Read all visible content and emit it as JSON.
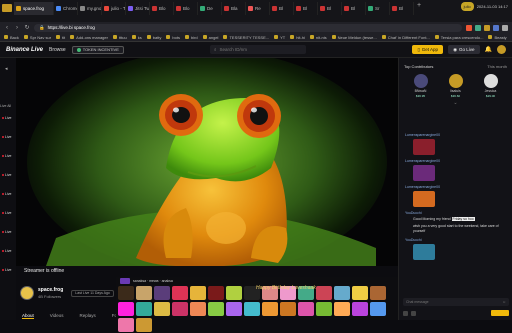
{
  "browser": {
    "tabs": [
      {
        "label": "space.frog",
        "color": "#d9a21a",
        "active": true
      },
      {
        "label": "Chrome We",
        "color": "#4a8af4"
      },
      {
        "label": "my.gnome.h",
        "color": "#888888"
      },
      {
        "label": "julio - Thonie",
        "color": "#e9483b"
      },
      {
        "label": "Jitsi Twent",
        "color": "#7b5df2"
      },
      {
        "label": "Blo",
        "color": "#c33"
      },
      {
        "label": "Blo",
        "color": "#c33"
      },
      {
        "label": "De",
        "color": "#3a7"
      },
      {
        "label": "Bla",
        "color": "#c33"
      },
      {
        "label": "Re",
        "color": "#e55"
      },
      {
        "label": "Bl",
        "color": "#c33"
      },
      {
        "label": "Bl",
        "color": "#c33"
      },
      {
        "label": "Bl",
        "color": "#c33"
      },
      {
        "label": "Bl",
        "color": "#c33"
      },
      {
        "label": "Sr",
        "color": "#3a7"
      },
      {
        "label": "Bl",
        "color": "#c33"
      }
    ],
    "clock": "2024-11-03 14:17",
    "user_chip": "julio",
    "url_host": "space.frog",
    "url_full": "https://live.bi space.frog",
    "bookmarks": [
      "Back",
      "Spr Nav sur",
      "tit",
      "Add-ons manager",
      "tttuu",
      "ks",
      "batty",
      "bots",
      "bird",
      "angel",
      "TESSERITY TESSE...",
      "YT",
      "hit-hi",
      "nit-nis",
      "Neue Meldun (tesse...",
      "Chat' in Different Font...",
      "Tersia para crescendo...",
      "Beasty",
      "crossroy",
      "Other Bookmarks"
    ]
  },
  "site": {
    "logo": "Binance Live",
    "browse": "Browse",
    "token_label": "TOKEN INCENTIVE",
    "search_placeholder": "Search ID/nm",
    "get_app": "Get App",
    "go_live": "Go Live"
  },
  "sidebar": {
    "section_label": "Live All",
    "live_label": "Live",
    "live_count": 9
  },
  "stream": {
    "status": "Streamer is offline",
    "channel_name": "space.frog",
    "followers": "4B Followers",
    "last_live": "Last Live 11 Days Ago",
    "tabs": [
      "About",
      "Videos",
      "Replays",
      "Fol"
    ]
  },
  "overlay": {
    "top_label": "sanaksa · mewa · anaksa",
    "birthday_text": "Happy Birthday Loveshaak"
  },
  "right_panel": {
    "top_contributors": "Top Contributors",
    "period": "This month",
    "contributors": [
      {
        "name": "BNwaN",
        "amount": "$36.95",
        "color": "#4a4a7a"
      },
      {
        "name": "lisaluis",
        "amount": "$36.60",
        "color": "#c69b26"
      },
      {
        "name": "Jessica",
        "amount": "$29.00",
        "color": "#dddddd"
      }
    ],
    "chat": [
      {
        "user": "Lumensparenargine00",
        "type": "gift",
        "color": "#8a1f2c"
      },
      {
        "user": "Lumensparenargine00",
        "type": "gift",
        "color": "#6b2a7a"
      },
      {
        "user": "Lumensparenargine00",
        "type": "gift",
        "color": "#d46a20"
      },
      {
        "user": "YouDucchi",
        "type": "text",
        "text": "Good Morning my friend",
        "highlight": "Friday so hoo"
      },
      {
        "user": "",
        "type": "text",
        "text": "wish you a very good start to the weekend, take care of yourself"
      },
      {
        "user": "YouDucchi",
        "type": "gift",
        "color": "#2e7c9b"
      }
    ],
    "chat_placeholder": "Chat message",
    "emoji_glyph": "☺"
  }
}
